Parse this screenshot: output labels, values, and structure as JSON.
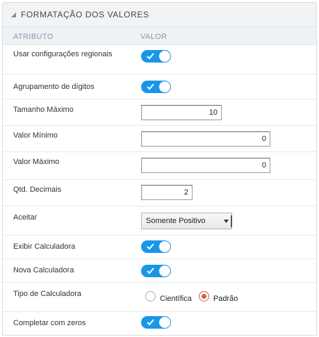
{
  "panel": {
    "title": "FORMATAÇÃO DOS VALORES",
    "icon": "collapse-triangle-icon"
  },
  "columns": {
    "attribute": "ATRIBUTO",
    "value": "VALOR"
  },
  "fields": {
    "regional": {
      "label": "Usar configurações regionais",
      "enabled": true
    },
    "grouping": {
      "label": "Agrupamento de dígitos",
      "enabled": true
    },
    "max_size": {
      "label": "Tamanho Máximo",
      "value": "10"
    },
    "min_value": {
      "label": "Valor Mínimo",
      "value": "0"
    },
    "max_value": {
      "label": "Valor Máximo",
      "value": "0"
    },
    "decimals": {
      "label": "Qtd. Decimais",
      "value": "2"
    },
    "accept": {
      "label": "Aceitar",
      "selected": "Somente Positivo"
    },
    "show_calc": {
      "label": "Exibir Calculadora",
      "enabled": true
    },
    "new_calc": {
      "label": "Nova Calculadora",
      "enabled": true
    },
    "calc_type": {
      "label": "Tipo de Calculadora",
      "options": [
        "Científica",
        "Padrão"
      ],
      "selected": "Padrão"
    },
    "zeros": {
      "label": "Completar com zeros",
      "enabled": true
    }
  },
  "colors": {
    "toggle_on": "#1a96e8",
    "radio_checked": "#d4613a",
    "header_bg": "#f2f3f5",
    "column_header_bg": "#ecf2f6"
  }
}
